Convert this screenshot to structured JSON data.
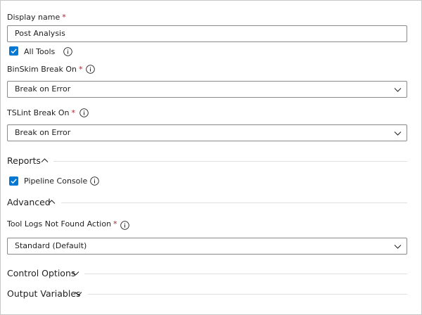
{
  "display_name": {
    "label": "Display name",
    "required": "*",
    "value": "Post Analysis"
  },
  "all_tools": {
    "label": "All Tools",
    "checked": true
  },
  "binskim": {
    "label": "BinSkim Break On",
    "required": "*",
    "value": "Break on Error"
  },
  "tslint": {
    "label": "TSLint Break On",
    "required": "*",
    "value": "Break on Error"
  },
  "reports": {
    "title": "Reports",
    "expanded": true,
    "pipeline_console": {
      "label": "Pipeline Console",
      "checked": true
    }
  },
  "advanced": {
    "title": "Advanced",
    "expanded": true,
    "tool_logs": {
      "label": "Tool Logs Not Found Action",
      "required": "*",
      "value": "Standard (Default)"
    }
  },
  "control_options": {
    "title": "Control Options",
    "expanded": false
  },
  "output_variables": {
    "title": "Output Variables",
    "expanded": false
  },
  "colors": {
    "accent": "#0078d4",
    "required": "#a4262c",
    "border": "#8a8886"
  },
  "icons": {
    "info": "info-icon",
    "chevron_down": "chevron-down-icon",
    "chevron_up": "chevron-up-icon",
    "check": "checkmark-icon"
  }
}
